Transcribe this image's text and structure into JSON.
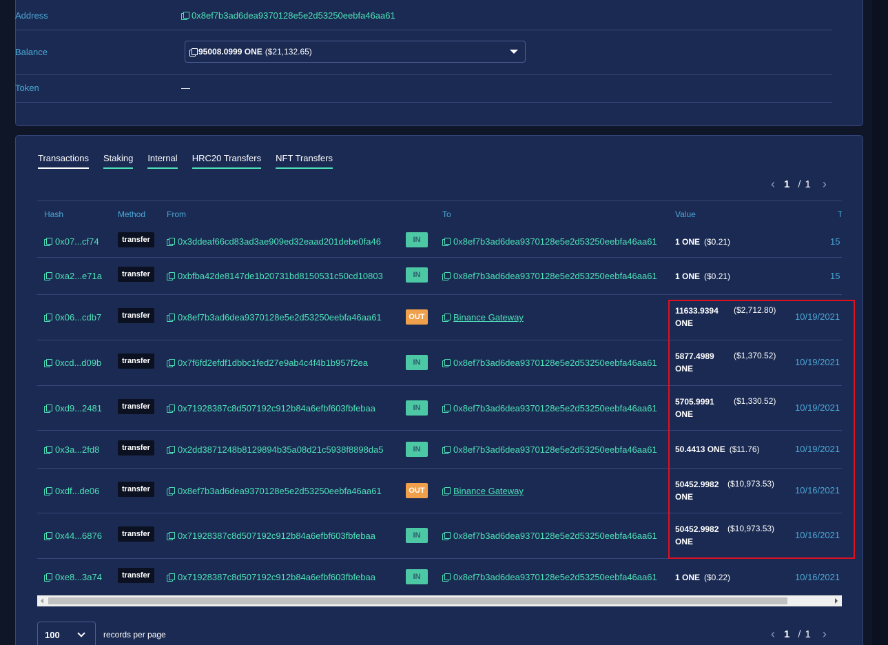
{
  "info": {
    "address_label": "Address",
    "address_value": "0x8ef7b3ad6dea9370128e5e2d53250eebfa46aa61",
    "balance_label": "Balance",
    "balance_amount": "95008.0999 ONE",
    "balance_usd": "($21,132.65)",
    "token_label": "Token",
    "token_value": "—"
  },
  "tabs": [
    "Transactions",
    "Staking",
    "Internal",
    "HRC20 Transfers",
    "NFT Transfers"
  ],
  "pager": {
    "current": "1",
    "separator": "/",
    "total": "1"
  },
  "columns": {
    "hash": "Hash",
    "method": "Method",
    "from": "From",
    "to": "To",
    "value": "Value",
    "timestamp": "T"
  },
  "rows": [
    {
      "hash": "0x07...cf74",
      "method": "transfer",
      "from": "0x3ddeaf66cd83ad3ae909ed32eaad201debe0fa46",
      "dir": "IN",
      "to": "0x8ef7b3ad6dea9370128e5e2d53250eebfa46aa61",
      "value_amount": "1 ONE",
      "value_unit": "",
      "value_usd": "($0.21)",
      "date": "15"
    },
    {
      "hash": "0xa2...e71a",
      "method": "transfer",
      "from": "0xbfba42de8147de1b20731bd8150531c50cd10803",
      "dir": "IN",
      "to": "0x8ef7b3ad6dea9370128e5e2d53250eebfa46aa61",
      "value_amount": "1 ONE",
      "value_unit": "",
      "value_usd": "($0.21)",
      "date": "15"
    },
    {
      "hash": "0x06...cdb7",
      "method": "transfer",
      "from": "0x8ef7b3ad6dea9370128e5e2d53250eebfa46aa61",
      "dir": "OUT",
      "to": "Binance Gateway",
      "value_amount": "11633.9394",
      "value_unit": "ONE",
      "value_usd": "($2,712.80)",
      "date": "10/19/2021"
    },
    {
      "hash": "0xcd...d09b",
      "method": "transfer",
      "from": "0x7f6fd2efdf1dbbc1fed27e9ab4c4f4b1b957f2ea",
      "dir": "IN",
      "to": "0x8ef7b3ad6dea9370128e5e2d53250eebfa46aa61",
      "value_amount": "5877.4989",
      "value_unit": "ONE",
      "value_usd": "($1,370.52)",
      "date": "10/19/2021"
    },
    {
      "hash": "0xd9...2481",
      "method": "transfer",
      "from": "0x71928387c8d507192c912b84a6efbf603fbfebaa",
      "dir": "IN",
      "to": "0x8ef7b3ad6dea9370128e5e2d53250eebfa46aa61",
      "value_amount": "5705.9991",
      "value_unit": "ONE",
      "value_usd": "($1,330.52)",
      "date": "10/19/2021"
    },
    {
      "hash": "0x3a...2fd8",
      "method": "transfer",
      "from": "0x2dd3871248b8129894b35a08d21c5938f8898da5",
      "dir": "IN",
      "to": "0x8ef7b3ad6dea9370128e5e2d53250eebfa46aa61",
      "value_amount": "50.4413 ONE",
      "value_unit": "",
      "value_usd": "($11.76)",
      "date": "10/19/2021"
    },
    {
      "hash": "0xdf...de06",
      "method": "transfer",
      "from": "0x8ef7b3ad6dea9370128e5e2d53250eebfa46aa61",
      "dir": "OUT",
      "to": "Binance Gateway",
      "value_amount": "50452.9982",
      "value_unit": "ONE",
      "value_usd": "($10,973.53)",
      "date": "10/16/2021"
    },
    {
      "hash": "0x44...6876",
      "method": "transfer",
      "from": "0x71928387c8d507192c912b84a6efbf603fbfebaa",
      "dir": "IN",
      "to": "0x8ef7b3ad6dea9370128e5e2d53250eebfa46aa61",
      "value_amount": "50452.9982",
      "value_unit": "ONE",
      "value_usd": "($10,973.53)",
      "date": "10/16/2021"
    },
    {
      "hash": "0xe8...3a74",
      "method": "transfer",
      "from": "0x71928387c8d507192c912b84a6efbf603fbfebaa",
      "dir": "IN",
      "to": "0x8ef7b3ad6dea9370128e5e2d53250eebfa46aa61",
      "value_amount": "1 ONE",
      "value_unit": "",
      "value_usd": "($0.22)",
      "date": "10/16/2021"
    }
  ],
  "footer": {
    "per_page_value": "100",
    "per_page_label": "records per page"
  },
  "colors": {
    "background": "#0f1628",
    "card": "#1b2a52",
    "accent": "#4de2b8",
    "label": "#4aa8d8",
    "in": "#4dc8a4",
    "out": "#f0a04a",
    "highlight": "#e01020"
  }
}
